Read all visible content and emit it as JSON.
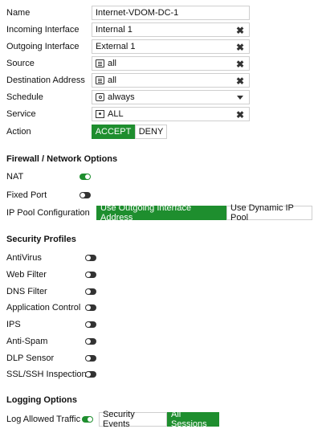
{
  "policy": {
    "name_label": "Name",
    "name_value": "Internet-VDOM-DC-1",
    "incoming_label": "Incoming Interface",
    "incoming_value": "Internal 1",
    "outgoing_label": "Outgoing Interface",
    "outgoing_value": "External 1",
    "source_label": "Source",
    "source_value": "all",
    "destination_label": "Destination Address",
    "destination_value": "all",
    "schedule_label": "Schedule",
    "schedule_value": "always",
    "service_label": "Service",
    "service_value": "ALL",
    "action_label": "Action",
    "action_accept": "ACCEPT",
    "action_deny": "DENY",
    "action_selected": "ACCEPT"
  },
  "firewall": {
    "title": "Firewall / Network Options",
    "nat_label": "NAT",
    "nat_on": true,
    "fixed_port_label": "Fixed Port",
    "fixed_port_on": false,
    "ippool_label": "IP Pool Configuration",
    "ippool_option1": "Use Outgoing Interface Address",
    "ippool_option2": "Use Dynamic IP Pool",
    "ippool_selected": "Use Outgoing Interface Address"
  },
  "security": {
    "title": "Security Profiles",
    "profiles": [
      {
        "label": "AntiVirus",
        "on": false
      },
      {
        "label": "Web Filter",
        "on": false
      },
      {
        "label": "DNS Filter",
        "on": false
      },
      {
        "label": "Application Control",
        "on": false
      },
      {
        "label": "IPS",
        "on": false
      },
      {
        "label": "Anti-Spam",
        "on": false
      },
      {
        "label": "DLP Sensor",
        "on": false
      },
      {
        "label": "SSL/SSH Inspection",
        "on": false
      }
    ]
  },
  "logging": {
    "title": "Logging Options",
    "log_allowed_label": "Log Allowed Traffic",
    "log_allowed_on": true,
    "option_security": "Security Events",
    "option_all": "All Sessions",
    "selected": "All Sessions"
  },
  "colors": {
    "accent_green": "#1e8e2e",
    "border_gray": "#cfcfcf"
  }
}
